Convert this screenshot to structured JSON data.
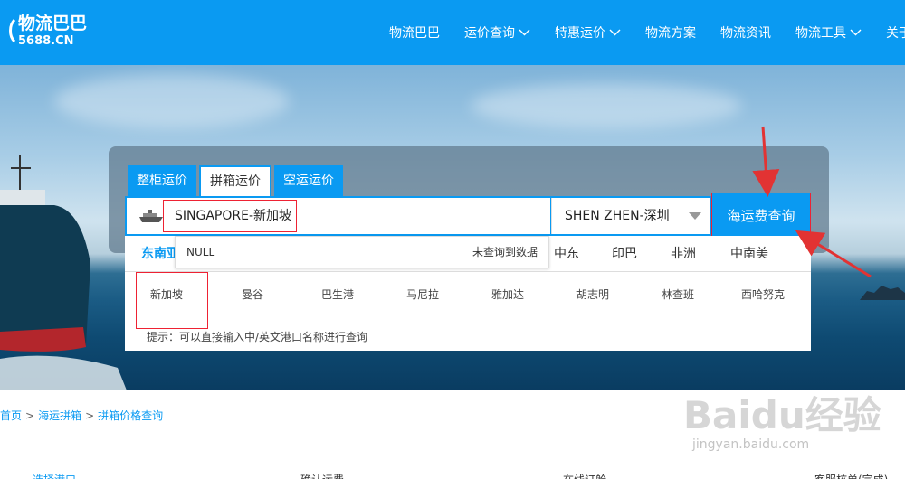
{
  "header": {
    "logo_cn": "物流巴巴",
    "logo_en": "5688.CN",
    "nav": [
      {
        "label": "物流巴巴",
        "dropdown": false
      },
      {
        "label": "运价查询",
        "dropdown": true
      },
      {
        "label": "特惠运价",
        "dropdown": true
      },
      {
        "label": "物流方案",
        "dropdown": false
      },
      {
        "label": "物流资讯",
        "dropdown": false
      },
      {
        "label": "物流工具",
        "dropdown": true
      },
      {
        "label": "关于",
        "dropdown": false
      }
    ]
  },
  "search": {
    "tabs": [
      "整柜运价",
      "拼箱运价",
      "空运运价"
    ],
    "active_tab": 1,
    "origin_value": "SINGAPORE-新加坡",
    "destination_value": "SHEN ZHEN-深圳",
    "button_label": "海运费查询",
    "dropdown_left": "NULL",
    "dropdown_right": "未查询到数据"
  },
  "regions": {
    "tabs": [
      "东南亚",
      "中东",
      "印巴",
      "非洲",
      "中南美"
    ],
    "ports": [
      "新加坡",
      "曼谷",
      "巴生港",
      "马尼拉",
      "雅加达",
      "胡志明",
      "林查班",
      "西哈努克"
    ],
    "hint": "提示：可以直接输入中/英文港口名称进行查询"
  },
  "breadcrumb": [
    "首页",
    "海运拼箱",
    "拼箱价格查询"
  ],
  "steps": [
    "选择港口",
    "确认运费",
    "在线订舱",
    "客服核单(完成)"
  ],
  "watermark": {
    "text": "Baidu经验",
    "url": "jingyan.baidu.com"
  },
  "colors": {
    "brand": "#0a9af2",
    "annotation": "#e23333"
  }
}
